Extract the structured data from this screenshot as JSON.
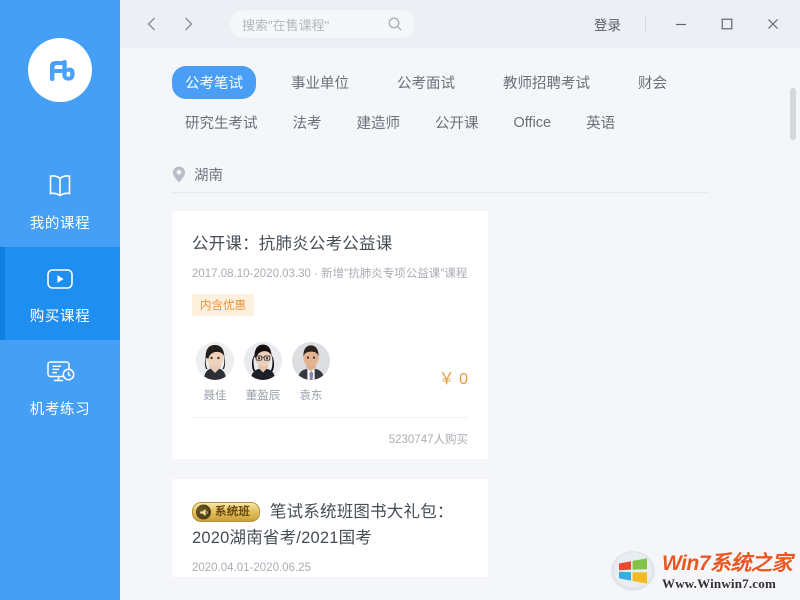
{
  "app": {
    "brand_logo": "fenbi-logo",
    "accent_blue": "#45a0f5",
    "active_blue": "#1e8ff0",
    "bg": "#f4f6f9",
    "price_orange": "#e79a3c"
  },
  "sidebar": {
    "items": [
      {
        "label": "我的课程",
        "icon": "book-icon",
        "active": false
      },
      {
        "label": "购买课程",
        "icon": "play-video-icon",
        "active": true
      },
      {
        "label": "机考练习",
        "icon": "monitor-clock-icon",
        "active": false
      }
    ]
  },
  "titlebar": {
    "back_icon": "chevron-left-icon",
    "forward_icon": "chevron-right-icon",
    "search": {
      "value": "",
      "placeholder": "搜索\"在售课程\"",
      "icon": "search-icon"
    },
    "login_label": "登录",
    "minimize_icon": "minimize-icon",
    "maximize_icon": "maximize-icon",
    "close_icon": "close-icon"
  },
  "tabs": {
    "row1": [
      {
        "label": "公考笔试",
        "active": true
      },
      {
        "label": "事业单位",
        "active": false
      },
      {
        "label": "公考面试",
        "active": false
      },
      {
        "label": "教师招聘考试",
        "active": false
      },
      {
        "label": "财会",
        "active": false
      }
    ],
    "row2": [
      {
        "label": "研究生考试",
        "active": false
      },
      {
        "label": "法考",
        "active": false
      },
      {
        "label": "建造师",
        "active": false
      },
      {
        "label": "公开课",
        "active": false
      },
      {
        "label": "Office",
        "active": false
      },
      {
        "label": "英语",
        "active": false
      }
    ]
  },
  "location": {
    "icon": "location-pin-icon",
    "value": "湖南"
  },
  "cards": [
    {
      "badge": null,
      "title": "公开课：抗肺炎公考公益课",
      "date": "2017.08.10-2020.03.30 · 新增\"抗肺炎专项公益课\"课程",
      "tag": "内含优惠",
      "teachers": [
        {
          "name": "聂佳",
          "avatar": "teacher-avatar-female-1"
        },
        {
          "name": "董盈辰",
          "avatar": "teacher-avatar-female-2"
        },
        {
          "name": "袁东",
          "avatar": "teacher-avatar-male-1"
        }
      ],
      "price": "￥ 0",
      "buy_count": "5230747人购买"
    },
    {
      "badge": {
        "label": "系统班",
        "icon": "horn-icon"
      },
      "title": "笔试系统班图书大礼包：2020湖南省考/2021国考",
      "date": "2020.04.01-2020.06.25",
      "tag": null,
      "teachers": [],
      "price": "",
      "buy_count": ""
    }
  ],
  "scrollbar": {
    "position_pct": 8
  },
  "watermark": {
    "logo": "windows-logo-icon",
    "title": "Win7系统之家",
    "url": "Www.Winwin7.com"
  }
}
